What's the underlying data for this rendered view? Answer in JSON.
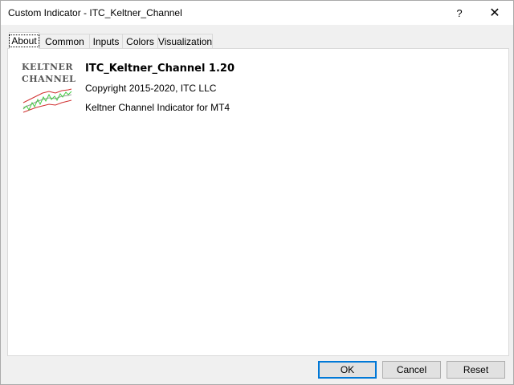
{
  "window": {
    "title": "Custom Indicator - ITC_Keltner_Channel",
    "help_glyph": "?",
    "close_glyph": "✕"
  },
  "tabs": [
    {
      "label": "About",
      "active": true
    },
    {
      "label": "Common",
      "active": false
    },
    {
      "label": "Inputs",
      "active": false
    },
    {
      "label": "Colors",
      "active": false
    },
    {
      "label": "Visualization",
      "active": false
    }
  ],
  "about": {
    "logo_line1": "KELTNER",
    "logo_line2": "CHANNEL",
    "name": "ITC_Keltner_Channel 1.20",
    "copyright": "Copyright 2015-2020, ITC LLC",
    "description": "Keltner Channel Indicator for MT4"
  },
  "buttons": {
    "ok": "OK",
    "cancel": "Cancel",
    "reset": "Reset"
  },
  "colors": {
    "accent": "#0078d7",
    "logo_upper": "#d03030",
    "logo_lower": "#d03030",
    "logo_mid": "#999999",
    "logo_price": "#44cc44"
  }
}
